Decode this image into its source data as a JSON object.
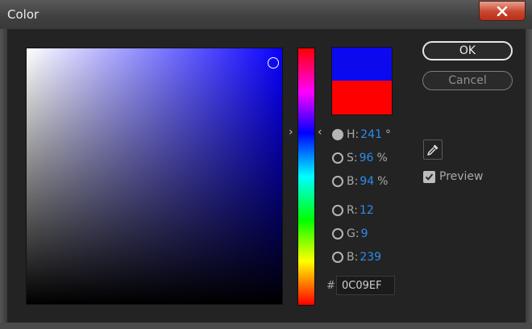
{
  "window": {
    "title": "Color"
  },
  "color": {
    "new": "#0c09ef",
    "old": "#ff0000"
  },
  "hsb": {
    "h": {
      "label": "H:",
      "value": "241",
      "unit": "°"
    },
    "s": {
      "label": "S:",
      "value": "96",
      "unit": "%"
    },
    "b": {
      "label": "B:",
      "value": "94",
      "unit": "%"
    }
  },
  "rgb": {
    "r": {
      "label": "R:",
      "value": "12"
    },
    "g": {
      "label": "G:",
      "value": "9"
    },
    "b": {
      "label": "B:",
      "value": "239"
    }
  },
  "hex": {
    "prefix": "#",
    "value": "0C09EF"
  },
  "buttons": {
    "ok": "OK",
    "cancel": "Cancel"
  },
  "preview": {
    "label": "Preview",
    "checked": true
  },
  "selected_channel": "H",
  "icons": {
    "close": "close-icon",
    "eyedropper": "eyedropper-icon",
    "checkmark": "checkmark-icon"
  }
}
